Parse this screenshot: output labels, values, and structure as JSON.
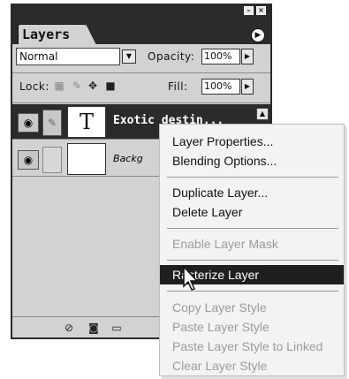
{
  "panel": {
    "title_tab": "Layers",
    "window_buttons": [
      "minimize-icon",
      "close-icon"
    ],
    "palette_menu_icon": "triangle-right-icon",
    "blend_mode": "Normal",
    "opacity_label": "Opacity:",
    "opacity_value": "100%",
    "lock_label": "Lock:",
    "fill_label": "Fill:",
    "fill_value": "100%",
    "layers": [
      {
        "name": "Exotic destin...",
        "thumb_text": "T",
        "selected": true
      },
      {
        "name": "Backg",
        "thumb_text": "",
        "selected": false
      }
    ],
    "bottom_icons": [
      "layer-style-icon",
      "mask-icon",
      "new-set-icon"
    ]
  },
  "context_menu": {
    "groups": [
      [
        {
          "label": "Layer Properties...",
          "enabled": true
        },
        {
          "label": "Blending Options...",
          "enabled": true
        }
      ],
      [
        {
          "label": "Duplicate Layer...",
          "enabled": true
        },
        {
          "label": "Delete Layer",
          "enabled": true
        }
      ],
      [
        {
          "label": "Enable Layer Mask",
          "enabled": false
        }
      ],
      [
        {
          "label": "Rasterize Layer",
          "enabled": true,
          "highlighted": true
        }
      ],
      [
        {
          "label": "Copy Layer Style",
          "enabled": false
        },
        {
          "label": "Paste Layer Style",
          "enabled": false
        },
        {
          "label": "Paste Layer Style to Linked",
          "enabled": false
        },
        {
          "label": "Clear Layer Style",
          "enabled": false
        }
      ]
    ]
  }
}
